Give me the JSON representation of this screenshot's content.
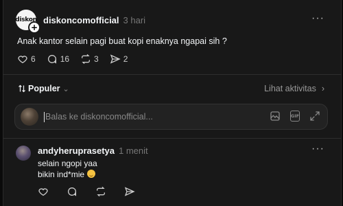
{
  "post": {
    "username": "diskoncomofficial",
    "avatar_text": "diskon",
    "time": "3 hari",
    "text": "Anak kantor selain pagi buat kopi enaknya ngapai sih ?",
    "likes": "6",
    "comments": "16",
    "reposts": "3",
    "shares": "2"
  },
  "sort": {
    "label": "Populer",
    "icon": "sort-arrows-icon"
  },
  "activity_link": "Lihat aktivitas",
  "reply": {
    "placeholder": "Balas ke diskoncomofficial..."
  },
  "comments": [
    {
      "username": "andyheruprasetya",
      "time": "1 menit",
      "line1": "selain ngopi yaa",
      "line2": "bikin ind*mie"
    }
  ],
  "colors": {
    "background": "#0a0a0a",
    "card": "#181818",
    "text": "#f3f5f7",
    "muted": "#777777"
  }
}
